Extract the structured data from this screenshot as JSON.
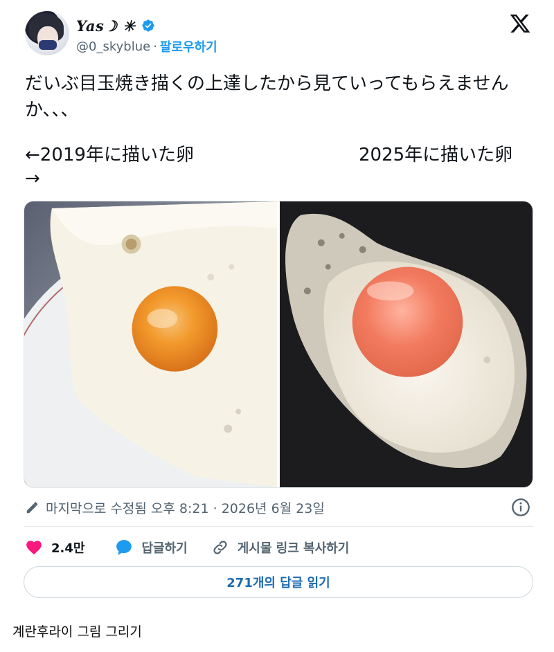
{
  "author": {
    "display_name": "Yas☽ ✳",
    "handle": "@0_skyblue",
    "separator": "·",
    "follow_label": "팔로우하기"
  },
  "tweet": {
    "text": "だいぶ目玉焼き描くの上達したから見ていってもらえませんか、、、",
    "caption_left": "←2019年に描いた卵",
    "caption_arrow": "→",
    "caption_right": "2025年に描いた卵"
  },
  "edited": {
    "text": "마지막으로 수정됨 오후 8:21 · 2026년 6월 23일"
  },
  "actions": {
    "like_count": "2.4만",
    "reply_label": "답글하기",
    "copy_link_label": "게시물 링크 복사하기"
  },
  "read_replies_label": "271개의 답글 읽기",
  "footer_caption": "계란후라이 그림 그리기",
  "colors": {
    "accent": "#1d9bf0",
    "like": "#f91880",
    "text_secondary": "#536471"
  },
  "icons": {
    "platform": "x-logo-icon",
    "verified": "verified-badge-icon",
    "edit": "pencil-icon",
    "info": "info-icon",
    "like": "heart-icon",
    "reply": "speech-bubble-icon",
    "copy_link": "link-icon"
  }
}
